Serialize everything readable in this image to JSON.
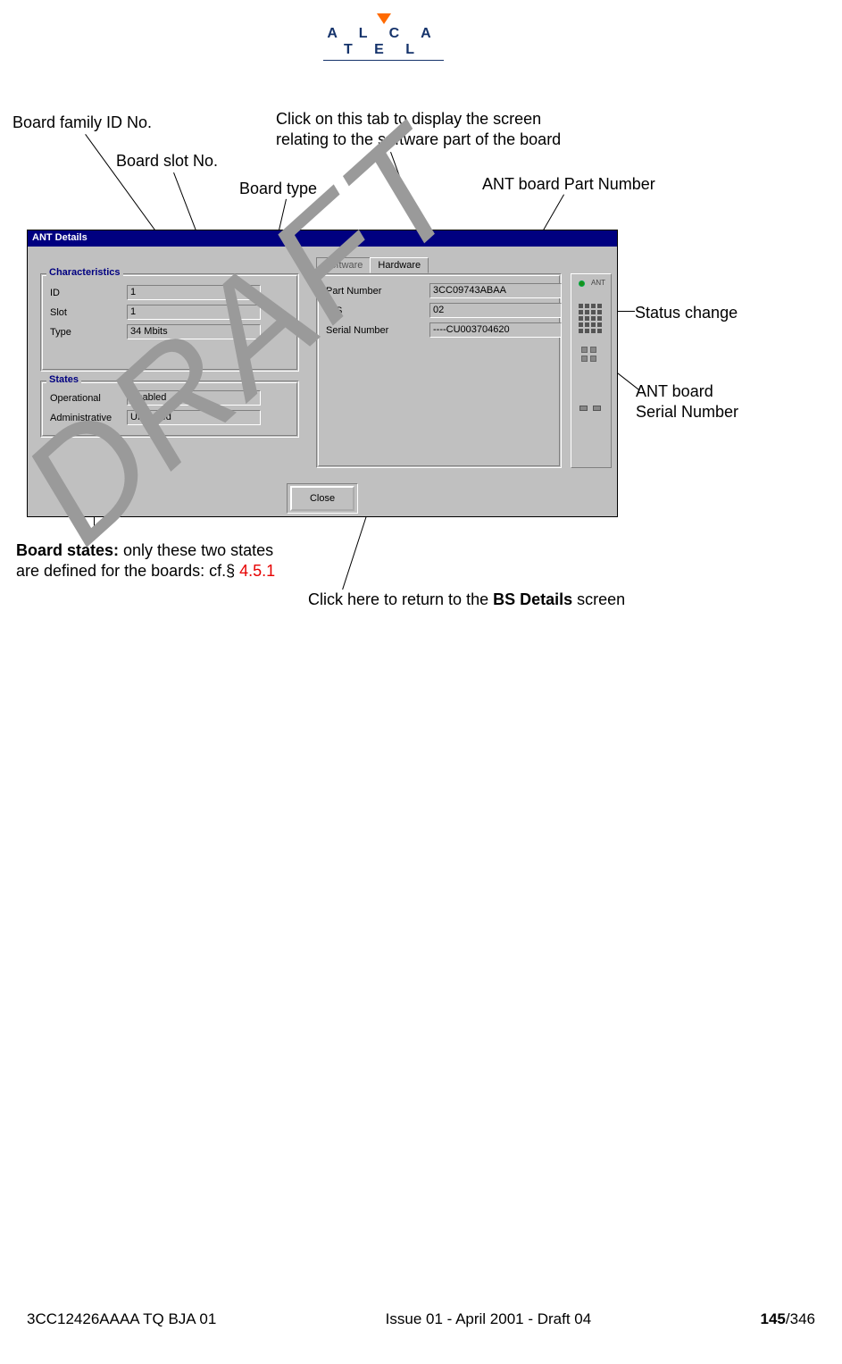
{
  "logo": {
    "brand": "A L C A T E L"
  },
  "annotations": {
    "family_id": "Board family ID No.",
    "slot_no": "Board slot No.",
    "board_type": "Board  type",
    "soft_tab": "Click on this tab to display the screen\nrelating to the software part of the board",
    "part_number": "ANT board Part Number",
    "status_change": "Status change",
    "serial_number": "ANT board\nSerial Number",
    "close_note": "Click here to return to the BS Details screen",
    "states_note_prefix": "Board states:",
    "states_note_body": " only these two states\nare defined for the boards: cf.§ ",
    "states_note_ref": "4.5.1"
  },
  "window": {
    "title": "ANT Details",
    "tabs": {
      "software": "Software",
      "hardware": "Hardware"
    },
    "characteristics": {
      "legend": "Characteristics",
      "id_label": "ID",
      "id_value": "1",
      "slot_label": "Slot",
      "slot_value": "1",
      "type_label": "Type",
      "type_value": "34 Mbits"
    },
    "states": {
      "legend": "States",
      "operational_label": "Operational",
      "operational_value": "Enabled",
      "administrative_label": "Administrative",
      "administrative_value": "Unlocked"
    },
    "hw": {
      "pn_label": "Part Number",
      "pn_value": "3CC09743ABAA",
      "ics_label": "ICS",
      "ics_value": "02",
      "sn_label": "Serial Number",
      "sn_value": "----CU003704620"
    },
    "ant_label": "ANT",
    "close": "Close"
  },
  "footer": {
    "left": "3CC12426AAAA TQ BJA 01",
    "center": "Issue 01 - April 2001 - Draft 04",
    "page": "145",
    "total": "/346"
  },
  "watermark": "DRAFT"
}
